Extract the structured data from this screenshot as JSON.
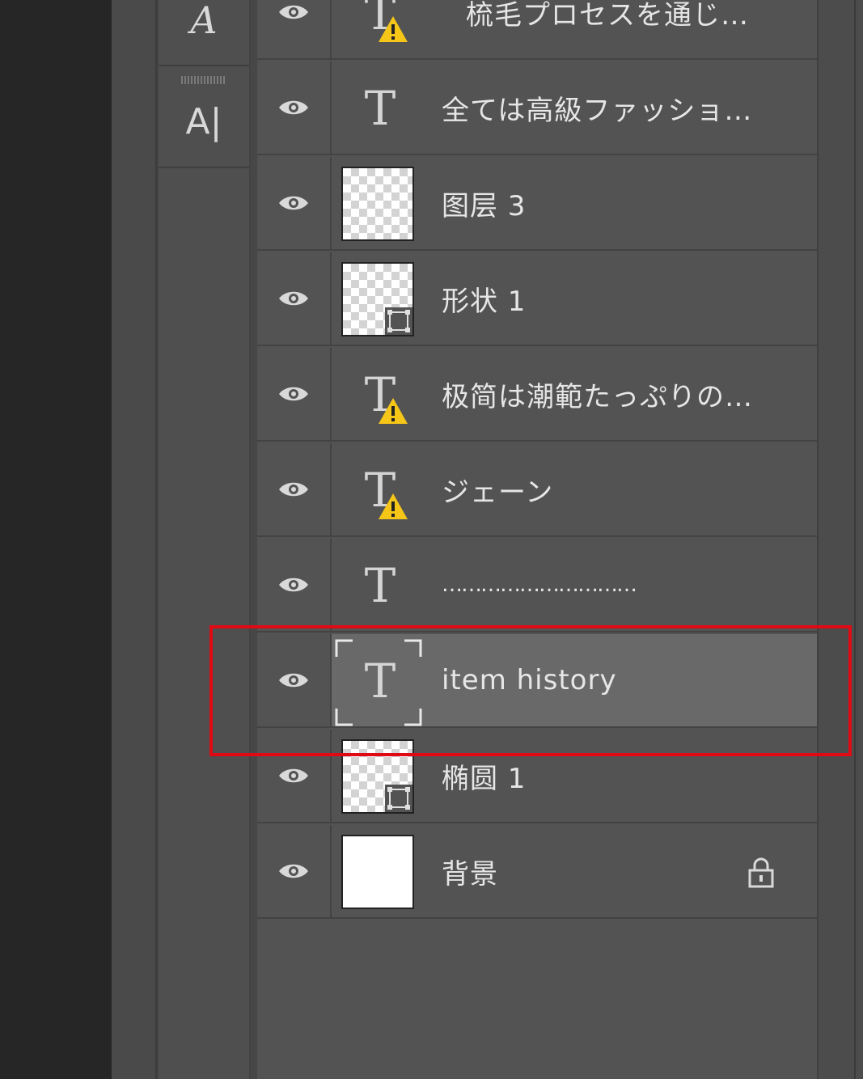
{
  "tools": [
    {
      "name": "character-panel",
      "glyph": "A",
      "icon": "character-style-icon"
    },
    {
      "name": "paragraph-panel",
      "glyph": "A|",
      "icon": "paragraph-style-icon"
    }
  ],
  "layers": [
    {
      "name": "梳毛プロセスを通じ…",
      "kind": "text",
      "warning": true,
      "visible": true
    },
    {
      "name": "全ては高級ファッショ…",
      "kind": "text",
      "warning": false,
      "visible": true
    },
    {
      "name": "图层 3",
      "kind": "pixel",
      "visible": true
    },
    {
      "name": "形状 1",
      "kind": "shape",
      "visible": true
    },
    {
      "name": "极简は潮範たっぷりの…",
      "kind": "text",
      "warning": true,
      "visible": true
    },
    {
      "name": "ジェーン",
      "kind": "text",
      "warning": true,
      "visible": true
    },
    {
      "name": "…………………………",
      "kind": "text",
      "warning": false,
      "visible": true
    },
    {
      "name": "item history",
      "kind": "text",
      "warning": false,
      "visible": true,
      "selected": true
    },
    {
      "name": "椭圆 1",
      "kind": "shape",
      "visible": true
    },
    {
      "name": "背景",
      "kind": "background",
      "visible": true,
      "locked": true
    }
  ],
  "colors": {
    "panel_bg": "#535353",
    "selected_row": "#696969",
    "highlight_box": "#e00a14",
    "warning": "#f5c518"
  }
}
